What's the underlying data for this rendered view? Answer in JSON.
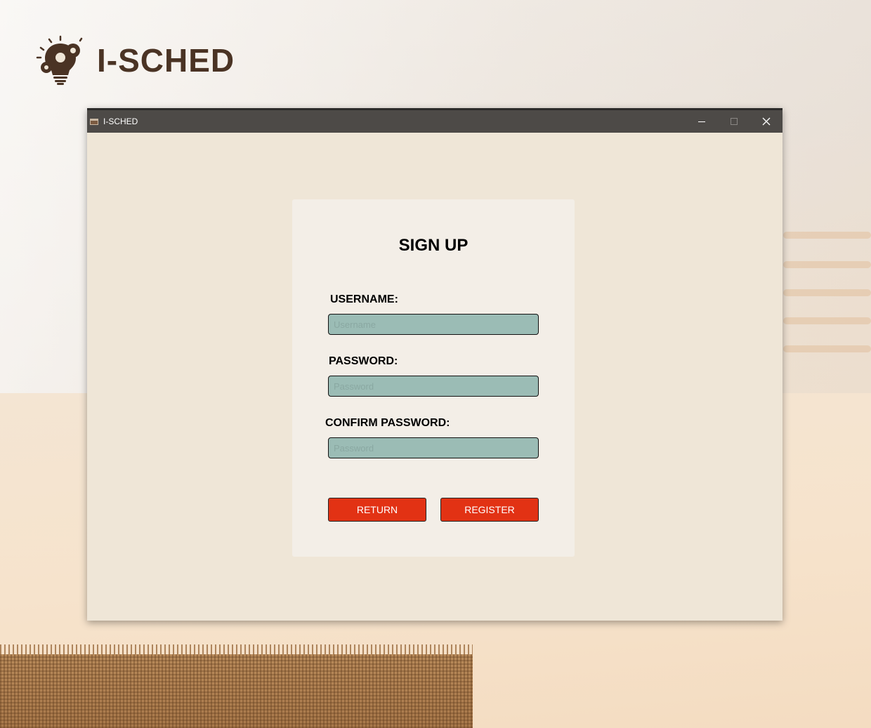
{
  "brand": {
    "name": "I-SCHED",
    "logo_icon": "lightbulb-gears-icon",
    "color": "#4a3324"
  },
  "window": {
    "title": "I-SCHED",
    "icon": "app-icon",
    "controls": {
      "minimize": "minimize-icon",
      "maximize": "maximize-icon",
      "close": "close-icon"
    }
  },
  "form": {
    "title": "SIGN UP",
    "username": {
      "label": "USERNAME:",
      "placeholder": "Username",
      "value": ""
    },
    "password": {
      "label": "PASSWORD:",
      "placeholder": "Password",
      "value": ""
    },
    "confirm_password": {
      "label": "CONFIRM PASSWORD:",
      "placeholder": "Password",
      "value": ""
    },
    "buttons": {
      "return_label": "RETURN",
      "register_label": "REGISTER"
    }
  },
  "colors": {
    "accent": "#e23214",
    "input_fill": "#9bbcb5",
    "window_bg": "#efe6d7",
    "titlebar": "#4d4a47"
  }
}
